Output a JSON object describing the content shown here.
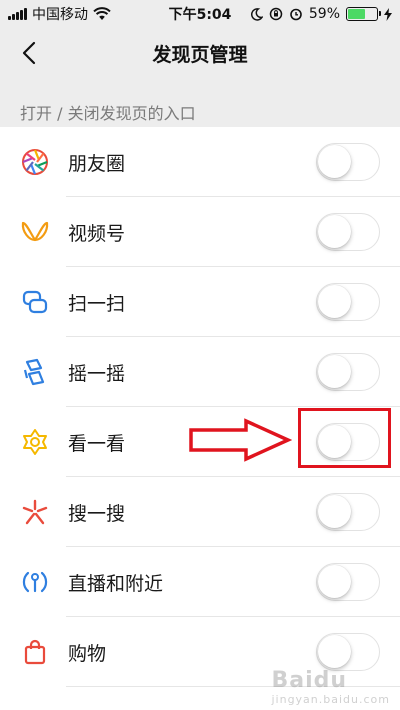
{
  "status_bar": {
    "carrier": "中国移动",
    "time": "下午5:04",
    "battery_percent": "59%",
    "battery_level": 0.59,
    "icons": [
      "signal-icon",
      "wifi-icon",
      "moon-icon",
      "lock-rotation-icon",
      "alarm-icon",
      "battery-icon",
      "charging-icon"
    ]
  },
  "nav": {
    "title": "发现页管理",
    "back_icon": "chevron-left-icon"
  },
  "section_header": "打开 / 关闭发现页的入口",
  "items": [
    {
      "label": "朋友圈",
      "icon": "moments-icon",
      "enabled": false
    },
    {
      "label": "视频号",
      "icon": "channels-icon",
      "enabled": false
    },
    {
      "label": "扫一扫",
      "icon": "scan-icon",
      "enabled": false
    },
    {
      "label": "摇一摇",
      "icon": "shake-icon",
      "enabled": false
    },
    {
      "label": "看一看",
      "icon": "top-stories-icon",
      "enabled": false
    },
    {
      "label": "搜一搜",
      "icon": "search-icon",
      "enabled": false
    },
    {
      "label": "直播和附近",
      "icon": "live-nearby-icon",
      "enabled": false
    },
    {
      "label": "购物",
      "icon": "shopping-bag-icon",
      "enabled": false
    }
  ],
  "annotation": {
    "color": "#e0141e",
    "highlight_target": "看一看"
  },
  "watermark": {
    "text": "Baidu",
    "subtext": "jingyan.baidu.com"
  },
  "colors": {
    "background": "#ededed",
    "list_background": "#ffffff",
    "toggle_off_border": "#e2e2e2",
    "battery_fill": "#4cd964"
  }
}
